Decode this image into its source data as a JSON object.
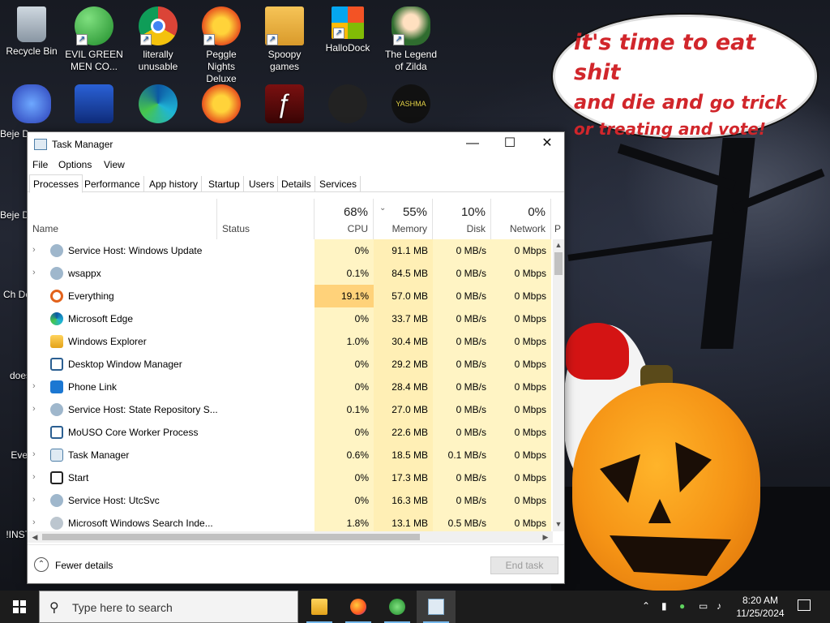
{
  "desktop": {
    "bubble": {
      "line1": "it's time to eat shit",
      "line2a": "and die and",
      "line2b": "go trick",
      "line3": "or treating and vote!"
    },
    "icons_row1": [
      {
        "label": "Recycle Bin",
        "icon": "recycle-bin-icon"
      },
      {
        "label": "EVIL GREEN MEN CO...",
        "icon": "green-men-icon"
      },
      {
        "label": "literally unusable",
        "icon": "chrome-icon"
      },
      {
        "label": "Peggle Nights Deluxe",
        "icon": "peggle-icon"
      },
      {
        "label": "Spoopy games",
        "icon": "folder-icon"
      },
      {
        "label": "HalloDock",
        "icon": "windows-logo-icon"
      },
      {
        "label": "The Legend of Zilda",
        "icon": "zilda-icon"
      }
    ],
    "side_labels": [
      {
        "label": "Beje De"
      },
      {
        "label": "Beje De"
      },
      {
        "label": "Ch De"
      },
      {
        "label": "does"
      },
      {
        "label": "Ever"
      },
      {
        "label": "!INST"
      }
    ]
  },
  "taskmanager": {
    "title": "Task Manager",
    "menu": [
      "File",
      "Options",
      "View"
    ],
    "tabs": [
      "Processes",
      "Performance",
      "App history",
      "Startup",
      "Users",
      "Details",
      "Services"
    ],
    "columns": {
      "name": "Name",
      "status": "Status",
      "cpu": {
        "pct": "68%",
        "label": "CPU"
      },
      "memory": {
        "pct": "55%",
        "label": "Memory"
      },
      "disk": {
        "pct": "10%",
        "label": "Disk"
      },
      "network": {
        "pct": "0%",
        "label": "Network"
      },
      "power_partial": "P"
    },
    "processes": [
      {
        "name": "Service Host: Windows Update",
        "expandable": true,
        "icon": "gear-icon",
        "cpu": "0%",
        "memory": "91.1 MB",
        "disk": "0 MB/s",
        "network": "0 Mbps"
      },
      {
        "name": "wsappx",
        "expandable": true,
        "icon": "gear-icon",
        "cpu": "0.1%",
        "memory": "84.5 MB",
        "disk": "0 MB/s",
        "network": "0 Mbps"
      },
      {
        "name": "Everything",
        "expandable": false,
        "icon": "magnifier-icon",
        "cpu": "19.1%",
        "memory": "57.0 MB",
        "disk": "0 MB/s",
        "network": "0 Mbps"
      },
      {
        "name": "Microsoft Edge",
        "expandable": false,
        "icon": "edge-icon",
        "cpu": "0%",
        "memory": "33.7 MB",
        "disk": "0 MB/s",
        "network": "0 Mbps"
      },
      {
        "name": "Windows Explorer",
        "expandable": false,
        "icon": "folder-icon",
        "cpu": "1.0%",
        "memory": "30.4 MB",
        "disk": "0 MB/s",
        "network": "0 Mbps"
      },
      {
        "name": "Desktop Window Manager",
        "expandable": false,
        "icon": "window-icon",
        "cpu": "0%",
        "memory": "29.2 MB",
        "disk": "0 MB/s",
        "network": "0 Mbps"
      },
      {
        "name": "Phone Link",
        "expandable": true,
        "icon": "phone-link-icon",
        "cpu": "0%",
        "memory": "28.4 MB",
        "disk": "0 MB/s",
        "network": "0 Mbps"
      },
      {
        "name": "Service Host: State Repository S...",
        "expandable": true,
        "icon": "gear-icon",
        "cpu": "0.1%",
        "memory": "27.0 MB",
        "disk": "0 MB/s",
        "network": "0 Mbps"
      },
      {
        "name": "MoUSO Core Worker Process",
        "expandable": false,
        "icon": "window-icon",
        "cpu": "0%",
        "memory": "22.6 MB",
        "disk": "0 MB/s",
        "network": "0 Mbps"
      },
      {
        "name": "Task Manager",
        "expandable": true,
        "icon": "task-manager-icon",
        "cpu": "0.6%",
        "memory": "18.5 MB",
        "disk": "0.1 MB/s",
        "network": "0 Mbps"
      },
      {
        "name": "Start",
        "expandable": true,
        "icon": "start-icon",
        "cpu": "0%",
        "memory": "17.3 MB",
        "disk": "0 MB/s",
        "network": "0 Mbps"
      },
      {
        "name": "Service Host: UtcSvc",
        "expandable": true,
        "icon": "gear-icon",
        "cpu": "0%",
        "memory": "16.3 MB",
        "disk": "0 MB/s",
        "network": "0 Mbps"
      },
      {
        "name": "Microsoft Windows Search Inde...",
        "expandable": true,
        "icon": "search-indexer-icon",
        "cpu": "1.8%",
        "memory": "13.1 MB",
        "disk": "0.5 MB/s",
        "network": "0 Mbps"
      }
    ],
    "footer": {
      "fewer_details": "Fewer details",
      "end_task": "End task"
    }
  },
  "taskbar": {
    "search_placeholder": "Type here to search",
    "time": "8:20 AM",
    "date": "11/25/2024",
    "pinned": [
      "file-explorer-icon",
      "firefox-icon",
      "green-men-icon",
      "task-manager-icon"
    ]
  },
  "colors": {
    "cpu_heat_low": "#fff4c4",
    "cpu_heat_high": "#ffd27a",
    "mem_heat": "#ffefb5",
    "disk_heat": "#fff4c4",
    "net_heat": "#fff4c4",
    "bubble_text": "#d1262b"
  }
}
